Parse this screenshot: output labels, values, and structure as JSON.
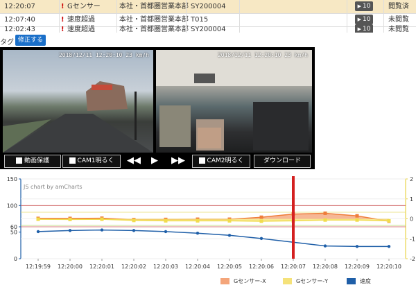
{
  "table": {
    "rows": [
      {
        "time": "12:20:07",
        "icon": "!",
        "event": "Gセンサー",
        "office": "本社・首都圏営業本部",
        "vehicle": "SY200004",
        "play": "10",
        "status": "閲覧済",
        "selected": true
      },
      {
        "time": "12:07:40",
        "icon": "!",
        "event": "速度超過",
        "office": "本社・首都圏営業本部",
        "vehicle": "T015",
        "play": "10",
        "status": "未閲覧",
        "selected": false
      },
      {
        "time": "12:02:43",
        "icon": "!",
        "event": "速度超過",
        "office": "本社・首都圏営業本部",
        "vehicle": "SY200004",
        "play": "10",
        "status": "未閲覧",
        "selected": false
      }
    ]
  },
  "tag": {
    "label": "タグ",
    "fix_button": "修正する"
  },
  "player": {
    "cam1_stamp": "2018/12/11 12:20:10  23 km/h",
    "cam2_stamp": "2018/12/11 12:20:10  23 km/h",
    "save_label": "動画保護",
    "cam1_bright_label": "CAM1明るく",
    "cam2_bright_label": "CAM2明るく",
    "download_label": "ダウンロード",
    "rewind_icon": "rewind-icon",
    "play_icon": "play-icon",
    "forward_icon": "fast-forward-icon"
  },
  "chart_data": {
    "type": "line",
    "credit": "JS chart by amCharts",
    "x": [
      "12:19:59",
      "12:20:00",
      "12:20:01",
      "12:20:02",
      "12:20:03",
      "12:20:04",
      "12:20:05",
      "12:20:06",
      "12:20:07",
      "12:20:08",
      "12:20:09",
      "12:20:10"
    ],
    "left_axis": {
      "ticks": [
        0,
        50,
        60,
        100,
        150
      ],
      "ylim": [
        0,
        150
      ]
    },
    "right_axis": {
      "ticks": [
        -2,
        -1,
        0,
        1,
        2
      ],
      "ylim": [
        -2,
        2
      ]
    },
    "highlight_x": "12:20:07",
    "left_thresholds": [
      60,
      100
    ],
    "series": [
      {
        "name": "Gセンサー-X",
        "axis": "right",
        "color": "#f4a57a",
        "marker": "#ef7d3a",
        "values": [
          0.02,
          0.02,
          0.03,
          -0.04,
          -0.03,
          -0.02,
          -0.02,
          0.08,
          0.24,
          0.28,
          0.15,
          -0.12
        ]
      },
      {
        "name": "Gセンサー-Y",
        "axis": "right",
        "color": "#f5e27a",
        "marker": "#f1dc4d",
        "values": [
          -0.02,
          -0.03,
          -0.02,
          -0.08,
          -0.1,
          -0.1,
          -0.1,
          -0.12,
          -0.1,
          -0.06,
          -0.06,
          -0.1
        ]
      },
      {
        "name": "速度",
        "axis": "left",
        "color": "#1f5fa8",
        "marker": "#1f5fa8",
        "values": [
          51,
          53,
          54,
          53,
          51,
          48,
          44,
          38,
          31,
          24,
          23,
          23
        ]
      }
    ]
  }
}
